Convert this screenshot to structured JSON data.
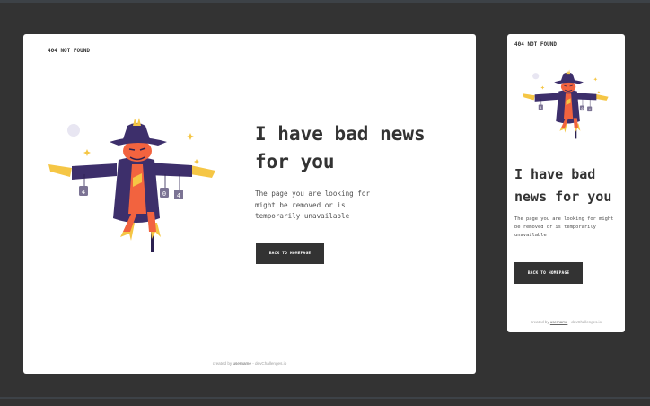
{
  "desktop": {
    "brand": "404 NOT FOUND",
    "heading": "I have bad news for you",
    "description": "The page you are looking for might be removed or is temporarily unavailable",
    "button_label": "BACK TO HOMEPAGE",
    "footer": {
      "prefix": "created by ",
      "username": "username",
      "suffix": " - devChallenges.io"
    }
  },
  "mobile": {
    "brand": "404 NOT FOUND",
    "heading": "I have bad news for you",
    "description": "The page you are looking for might be removed or is temporarily unavailable",
    "button_label": "BACK TO HOMEPAGE",
    "footer": {
      "prefix": "created by ",
      "username": "username",
      "suffix": " - devChallenges.io"
    }
  },
  "illustration": {
    "icon": "scarecrow-illustration",
    "sign_digits": [
      "4",
      "0",
      "4"
    ]
  },
  "colors": {
    "background": "#333333",
    "card": "#ffffff",
    "text": "#333333",
    "button": "#333333",
    "hat": "#3d2f6b",
    "face": "#f2633f",
    "straw": "#f5c645"
  }
}
